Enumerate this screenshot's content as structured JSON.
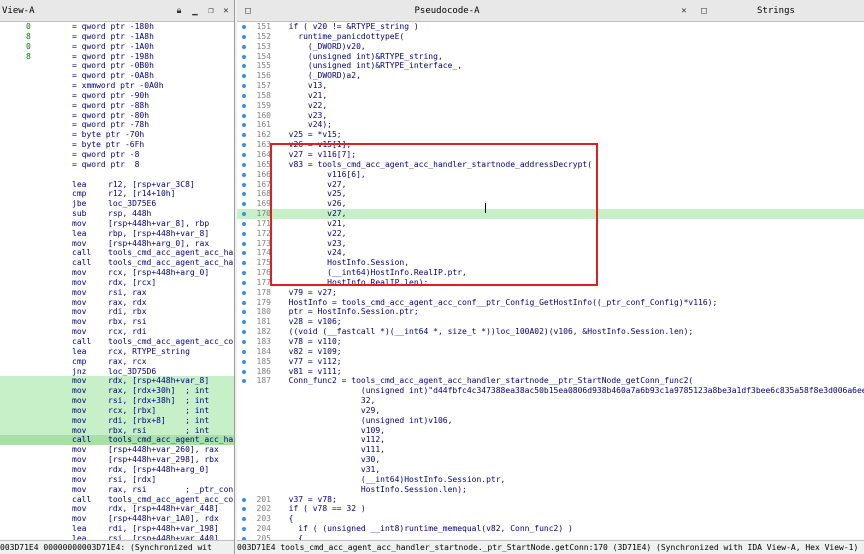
{
  "left_tab": {
    "title": "View-A"
  },
  "right_tab": {
    "title": "Pseudocode-A",
    "strings_title": "Strings"
  },
  "left_lines": [
    {
      "c1": "0",
      "c2": "= qword ptr -180h",
      "c3": ""
    },
    {
      "c1": "8",
      "c2": "= qword ptr -1A8h",
      "c3": ""
    },
    {
      "c1": "0",
      "c2": "= qword ptr -1A0h",
      "c3": ""
    },
    {
      "c1": "8",
      "c2": "= qword ptr -198h",
      "c3": ""
    },
    {
      "c1": "",
      "c2": "= qword ptr -0B0h",
      "c3": ""
    },
    {
      "c1": "",
      "c2": "= qword ptr -0A8h",
      "c3": ""
    },
    {
      "c1": "",
      "c2": "= xmmword ptr -0A0h",
      "c3": ""
    },
    {
      "c1": "",
      "c2": "= qword ptr -90h",
      "c3": ""
    },
    {
      "c1": "",
      "c2": "= qword ptr -88h",
      "c3": ""
    },
    {
      "c1": "",
      "c2": "= qword ptr -80h",
      "c3": ""
    },
    {
      "c1": "",
      "c2": "= qword ptr -78h",
      "c3": ""
    },
    {
      "c1": "",
      "c2": "= byte ptr -70h",
      "c3": ""
    },
    {
      "c1": "",
      "c2": "= byte ptr -6Fh",
      "c3": ""
    },
    {
      "c1": "",
      "c2": "= qword ptr -8",
      "c3": ""
    },
    {
      "c1": "",
      "c2": "= qword ptr  8",
      "c3": ""
    },
    {
      "c1": "",
      "c2": "",
      "c3": ""
    },
    {
      "c1": "",
      "c2": "lea",
      "c3": "r12, [rsp+var_3C8]"
    },
    {
      "c1": "",
      "c2": "cmp",
      "c3": "r12, [r14+10h]"
    },
    {
      "c1": "",
      "c2": "jbe",
      "c3": "loc_3D75E6"
    },
    {
      "c1": "",
      "c2": "sub",
      "c3": "rsp, 448h"
    },
    {
      "c1": "",
      "c2": "mov",
      "c3": "[rsp+448h+var_8], rbp"
    },
    {
      "c1": "",
      "c2": "lea",
      "c3": "rbp, [rsp+448h+var_8]"
    },
    {
      "c1": "",
      "c2": "mov",
      "c3": "[rsp+448h+arg_0], rax"
    },
    {
      "c1": "",
      "c2": "call",
      "c3": "tools_cmd_acc_agent_acc_ha"
    },
    {
      "c1": "",
      "c2": "call",
      "c3": "tools_cmd_acc_agent_acc_ha"
    },
    {
      "c1": "",
      "c2": "mov",
      "c3": "rcx, [rsp+448h+arg_0]"
    },
    {
      "c1": "",
      "c2": "mov",
      "c3": "rdx, [rcx]"
    },
    {
      "c1": "",
      "c2": "mov",
      "c3": "rsi, rax"
    },
    {
      "c1": "",
      "c2": "mov",
      "c3": "rax, rdx"
    },
    {
      "c1": "",
      "c2": "mov",
      "c3": "rdi, rbx"
    },
    {
      "c1": "",
      "c2": "mov",
      "c3": "rbx, rsi"
    },
    {
      "c1": "",
      "c2": "mov",
      "c3": "rcx, rdi"
    },
    {
      "c1": "",
      "c2": "call",
      "c3": "tools_cmd_acc_agent_acc_co"
    },
    {
      "c1": "",
      "c2": "lea",
      "c3": "rcx, RTYPE_string"
    },
    {
      "c1": "",
      "c2": "cmp",
      "c3": "rax, rcx"
    },
    {
      "c1": "",
      "c2": "jnz",
      "c3": "loc_3D75D6"
    },
    {
      "c1": "",
      "c2": "mov",
      "c3": "rdx, [rsp+448h+var_8]"
    },
    {
      "c1": "",
      "c2": "mov",
      "c3": "rax, [rdx+30h]  ; int"
    },
    {
      "c1": "",
      "c2": "mov",
      "c3": "rsi, [rdx+38h]  ; int"
    },
    {
      "c1": "",
      "c2": "mov",
      "c3": "rcx, [rbx]      ; int"
    },
    {
      "c1": "",
      "c2": "mov",
      "c3": "rdi, [rbx+8]    ; int"
    },
    {
      "c1": "",
      "c2": "mov",
      "c3": "rbx, rsi        ; int"
    },
    {
      "c1": "",
      "c2": "call",
      "c3": "tools_cmd_acc_agent_acc_ha"
    },
    {
      "c1": "",
      "c2": "mov",
      "c3": "[rsp+448h+var_260], rax"
    },
    {
      "c1": "",
      "c2": "mov",
      "c3": "[rsp+448h+var_298], rbx"
    },
    {
      "c1": "",
      "c2": "mov",
      "c3": "rdx, [rsp+448h+arg_0]"
    },
    {
      "c1": "",
      "c2": "mov",
      "c3": "rsi, [rdx]"
    },
    {
      "c1": "",
      "c2": "mov",
      "c3": "rax, rsi        ; _ptr_con"
    },
    {
      "c1": "",
      "c2": "call",
      "c3": "tools_cmd_acc_agent_acc_co"
    },
    {
      "c1": "",
      "c2": "mov",
      "c3": "rdx, [rsp+448h+var_448]"
    },
    {
      "c1": "",
      "c2": "mov",
      "c3": "[rsp+448h+var_1A0], rdx"
    },
    {
      "c1": "",
      "c2": "lea",
      "c3": "rdi, [rsp+448h+var_198]"
    },
    {
      "c1": "",
      "c2": "lea",
      "c3": "rsi, [rsp+448h+var_440]"
    },
    {
      "c1": "",
      "c2": "nop",
      "c3": "word ptr [rax+rax+00h]"
    }
  ],
  "right_lines": [
    {
      "n": "151",
      "t": "  if ( v20 != &RTYPE_string )"
    },
    {
      "n": "152",
      "t": "    runtime_panicdottypeE("
    },
    {
      "n": "153",
      "t": "      (_DWORD)v20,"
    },
    {
      "n": "154",
      "t": "      (unsigned int)&RTYPE_string,"
    },
    {
      "n": "155",
      "t": "      (unsigned int)&RTYPE_interface_,"
    },
    {
      "n": "156",
      "t": "      (_DWORD)a2,"
    },
    {
      "n": "157",
      "t": "      v13,"
    },
    {
      "n": "158",
      "t": "      v21,"
    },
    {
      "n": "159",
      "t": "      v22,"
    },
    {
      "n": "160",
      "t": "      v23,"
    },
    {
      "n": "161",
      "t": "      v24);"
    },
    {
      "n": "162",
      "t": "  v25 = *v15;"
    },
    {
      "n": "163",
      "t": "  v26 = v15[1];"
    },
    {
      "n": "164",
      "t": "  v27 = v116[7];"
    },
    {
      "n": "165",
      "t": "  v83 = tools_cmd_acc_agent_acc_handler_startnode_addressDecrypt("
    },
    {
      "n": "166",
      "t": "          v116[6],"
    },
    {
      "n": "167",
      "t": "          v27,"
    },
    {
      "n": "168",
      "t": "          v25,"
    },
    {
      "n": "169",
      "t": "          v26,"
    },
    {
      "n": "170",
      "t": "          v27,"
    },
    {
      "n": "171",
      "t": "          v21,"
    },
    {
      "n": "172",
      "t": "          v22,"
    },
    {
      "n": "173",
      "t": "          v23,"
    },
    {
      "n": "174",
      "t": "          v24,"
    },
    {
      "n": "175",
      "t": "          HostInfo.Session,"
    },
    {
      "n": "176",
      "t": "          (__int64)HostInfo.RealIP.ptr,"
    },
    {
      "n": "177",
      "t": "          HostInfo.RealIP.len);"
    },
    {
      "n": "178",
      "t": "  v79 = v27;"
    },
    {
      "n": "179",
      "t": "  HostInfo = tools_cmd_acc_agent_acc_conf__ptr_Config_GetHostInfo((_ptr_conf_Config)*v116);"
    },
    {
      "n": "180",
      "t": "  ptr = HostInfo.Session.ptr;"
    },
    {
      "n": "181",
      "t": "  v28 = v106;"
    },
    {
      "n": "182",
      "t": "  ((void (__fastcall *)(__int64 *, size_t *))loc_100A02)(v106, &HostInfo.Session.len);"
    },
    {
      "n": "183",
      "t": "  v78 = v110;"
    },
    {
      "n": "184",
      "t": "  v82 = v109;"
    },
    {
      "n": "185",
      "t": "  v77 = v112;"
    },
    {
      "n": "186",
      "t": "  v81 = v111;"
    },
    {
      "n": "187",
      "t": "  Conn_func2 = tools_cmd_acc_agent_acc_handler_startnode__ptr_StartNode_getConn_func2("
    },
    {
      "n": "",
      "t": "                 (unsigned int)\"d44fbfc4c347388ea38ac50b15ea0806d938b460a7a6b93c1a9785123a8be3a1df3bee6c835a58f8e3d006a6ee01394ddfbf"
    },
    {
      "n": "",
      "t": "                 32,"
    },
    {
      "n": "",
      "t": "                 v29,"
    },
    {
      "n": "",
      "t": "                 (unsigned int)v106,"
    },
    {
      "n": "",
      "t": "                 v109,"
    },
    {
      "n": "",
      "t": "                 v112,"
    },
    {
      "n": "",
      "t": "                 v111,"
    },
    {
      "n": "",
      "t": "                 v30,"
    },
    {
      "n": "",
      "t": "                 v31,"
    },
    {
      "n": "",
      "t": "                 (__int64)HostInfo.Session.ptr,"
    },
    {
      "n": "",
      "t": "                 HostInfo.Session.len);"
    },
    {
      "n": "201",
      "t": "  v37 = v78;"
    },
    {
      "n": "202",
      "t": "  if ( v78 == 32 )"
    },
    {
      "n": "203",
      "t": "  {"
    },
    {
      "n": "204",
      "t": "    if ( (unsigned __int8)runtime_memequal(v82, Conn_func2) )"
    },
    {
      "n": "205",
      "t": "    {"
    },
    {
      "n": "206",
      "t": "      v40 = (_BYTE *)runtime_growslice("
    }
  ],
  "status_left": "003D71E4 00000000003D71E4: (Synchronized wit",
  "status_right": "003D71E4 tools_cmd_acc_agent_acc_handler_startnode._ptr_StartNode.getConn:170 (3D71E4) (Synchronized with IDA View-A, Hex View-1)"
}
